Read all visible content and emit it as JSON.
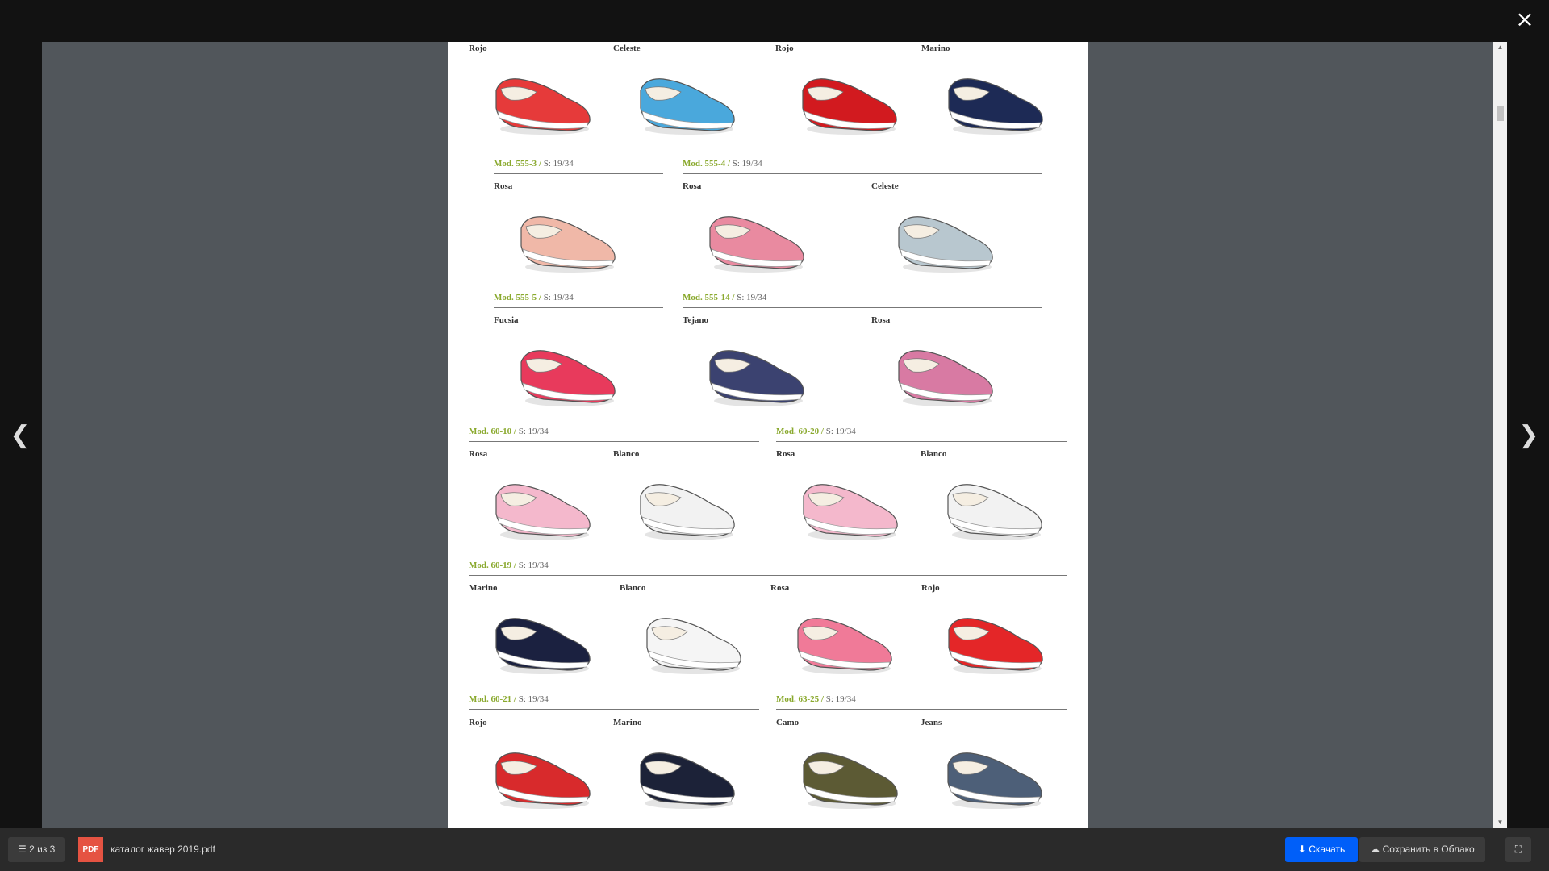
{
  "topbar": {
    "close_icon": "×"
  },
  "nav": {
    "prev_icon": "❮",
    "next_icon": "❯"
  },
  "catalog": {
    "top_row": [
      {
        "color": "Rojo",
        "shoe_color": "#e63a3a"
      },
      {
        "color": "Celeste",
        "shoe_color": "#4aa8dc"
      },
      {
        "color": "Rojo",
        "shoe_color": "#d21a1f"
      },
      {
        "color": "Marino",
        "shoe_color": "#1d2a55"
      }
    ],
    "sections": [
      {
        "mod": "Mod. 555-3 /",
        "size": "S: 19/34",
        "items": [
          {
            "color": "Rosa",
            "shoe_color": "#f0b8a8"
          }
        ]
      },
      {
        "mod": "Mod. 555-4 /",
        "size": "S: 19/34",
        "items": [
          {
            "color": "Rosa",
            "shoe_color": "#e98aa0"
          },
          {
            "color": "Celeste",
            "shoe_color": "#b8c7cf"
          }
        ]
      },
      {
        "mod": "Mod. 555-5 /",
        "size": "S: 19/34",
        "items": [
          {
            "color": "Fucsia",
            "shoe_color": "#e83a5c"
          }
        ]
      },
      {
        "mod": "Mod. 555-14 /",
        "size": "S: 19/34",
        "items": [
          {
            "color": "Tejano",
            "shoe_color": "#3b4270"
          },
          {
            "color": "Rosa",
            "shoe_color": "#d87aa3"
          }
        ]
      },
      {
        "mod": "Mod. 60-10 /",
        "size": "S: 19/34",
        "items": [
          {
            "color": "Rosa",
            "shoe_color": "#f4b8cc"
          },
          {
            "color": "Blanco",
            "shoe_color": "#f2f2f2"
          }
        ]
      },
      {
        "mod": "Mod. 60-20 /",
        "size": "S: 19/34",
        "items": [
          {
            "color": "Rosa",
            "shoe_color": "#f4b8cc"
          },
          {
            "color": "Blanco",
            "shoe_color": "#f2f2f2"
          }
        ]
      },
      {
        "mod": "Mod. 60-19 /",
        "size": "S: 19/34",
        "items": [
          {
            "color": "Marino",
            "shoe_color": "#1b2140"
          },
          {
            "color": "Blanco",
            "shoe_color": "#f5f5f5"
          },
          {
            "color": "Rosa",
            "shoe_color": "#f07a98"
          },
          {
            "color": "Rojo",
            "shoe_color": "#e42628"
          }
        ]
      },
      {
        "mod": "Mod. 60-21 /",
        "size": "S: 19/34",
        "items": [
          {
            "color": "Rojo",
            "shoe_color": "#d82a2c"
          },
          {
            "color": "Marino",
            "shoe_color": "#1c2238"
          }
        ]
      },
      {
        "mod": "Mod. 63-25 /",
        "size": "S: 19/34",
        "items": [
          {
            "color": "Camo",
            "shoe_color": "#5c5a34"
          },
          {
            "color": "Jeans",
            "shoe_color": "#4d5f78"
          }
        ]
      }
    ]
  },
  "bottombar": {
    "page_counter": "2 из 3",
    "menu_icon": "☰",
    "pdf_label": "PDF",
    "filename": "каталог жавер 2019.pdf",
    "download_label": "Скачать",
    "download_icon": "⬇",
    "cloud_label": "Сохранить в Облако",
    "cloud_icon": "☁",
    "fullscreen_icon": "⛶"
  }
}
